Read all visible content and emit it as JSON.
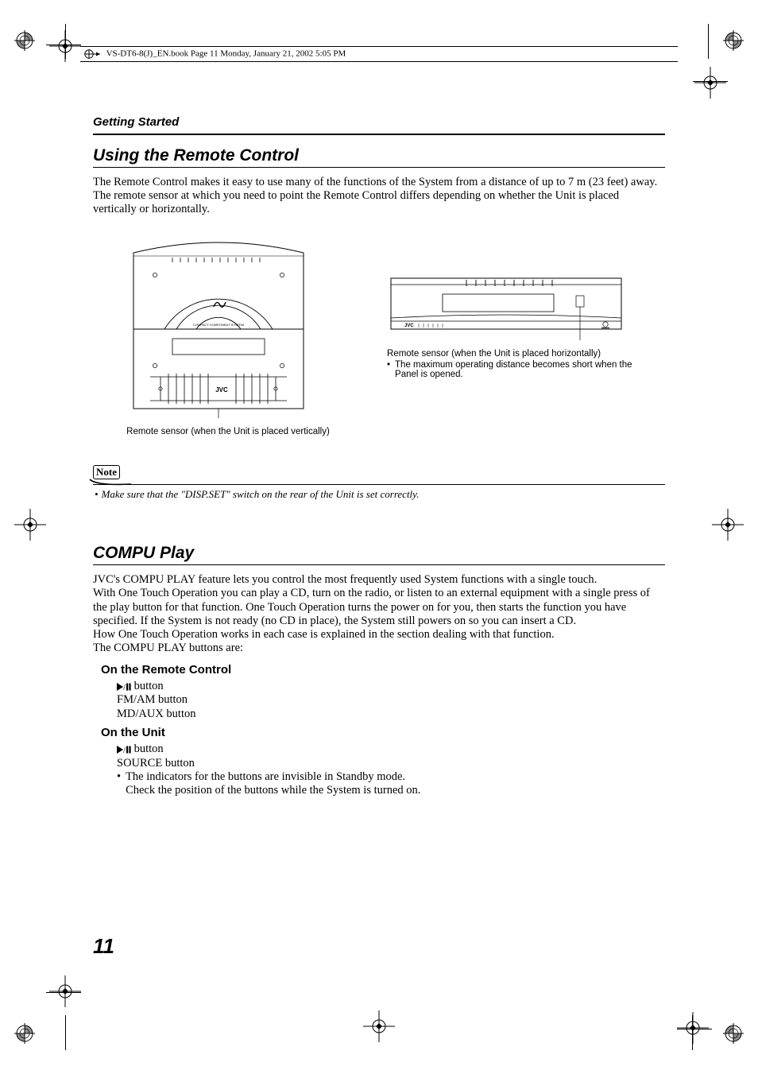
{
  "slug": "VS-DT6-8(J)_EN.book  Page 11  Monday, January 21, 2002  5:05 PM",
  "running_head": "Getting Started",
  "s1": {
    "title": "Using the Remote Control",
    "p1": "The Remote Control makes it easy to use many of the functions of the System from a distance of up to 7 m (23 feet) away. The remote sensor at which you need to point the Remote Control differs depending on whether the Unit is placed vertically or horizontally.",
    "capA": "Remote sensor (when the Unit is placed vertically)",
    "capB": "Remote sensor (when the Unit is placed horizontally)",
    "capB_bullet": "The maximum operating distance becomes short when the Panel is opened.",
    "figA_brand": "JVC",
    "figA_label": "COMPACT COMPONENT SYSTEM",
    "figB_brand": "JVC"
  },
  "note": {
    "label": "Note",
    "item": "Make sure that the \"DISP.SET\" switch on the rear of the Unit is set correctly."
  },
  "s2": {
    "title": "COMPU Play",
    "p1": "JVC's COMPU PLAY feature lets you control the most frequently used System functions with a single touch.",
    "p2": "With One Touch Operation you can play a CD, turn on the radio, or listen to an external equipment with a single press of the play button for that function. One Touch Operation turns the power on for you, then starts the function you have specified. If the System is not ready (no CD in place), the System still powers on so you can insert a CD.",
    "p3": "How One Touch Operation works in each case is explained in the section dealing with that function.",
    "p4": "The COMPU PLAY buttons are:",
    "remote_h": "On the Remote Control",
    "remote_items": {
      "b1_suffix": " button",
      "b2": "FM/AM button",
      "b3": "MD/AUX button"
    },
    "unit_h": "On the Unit",
    "unit_items": {
      "b1_suffix": " button",
      "b2": "SOURCE button",
      "bullet1": "The indicators for the buttons are invisible in Standby mode.",
      "bullet2": "Check the position of the buttons while the System is turned on."
    }
  },
  "page_number": "11"
}
